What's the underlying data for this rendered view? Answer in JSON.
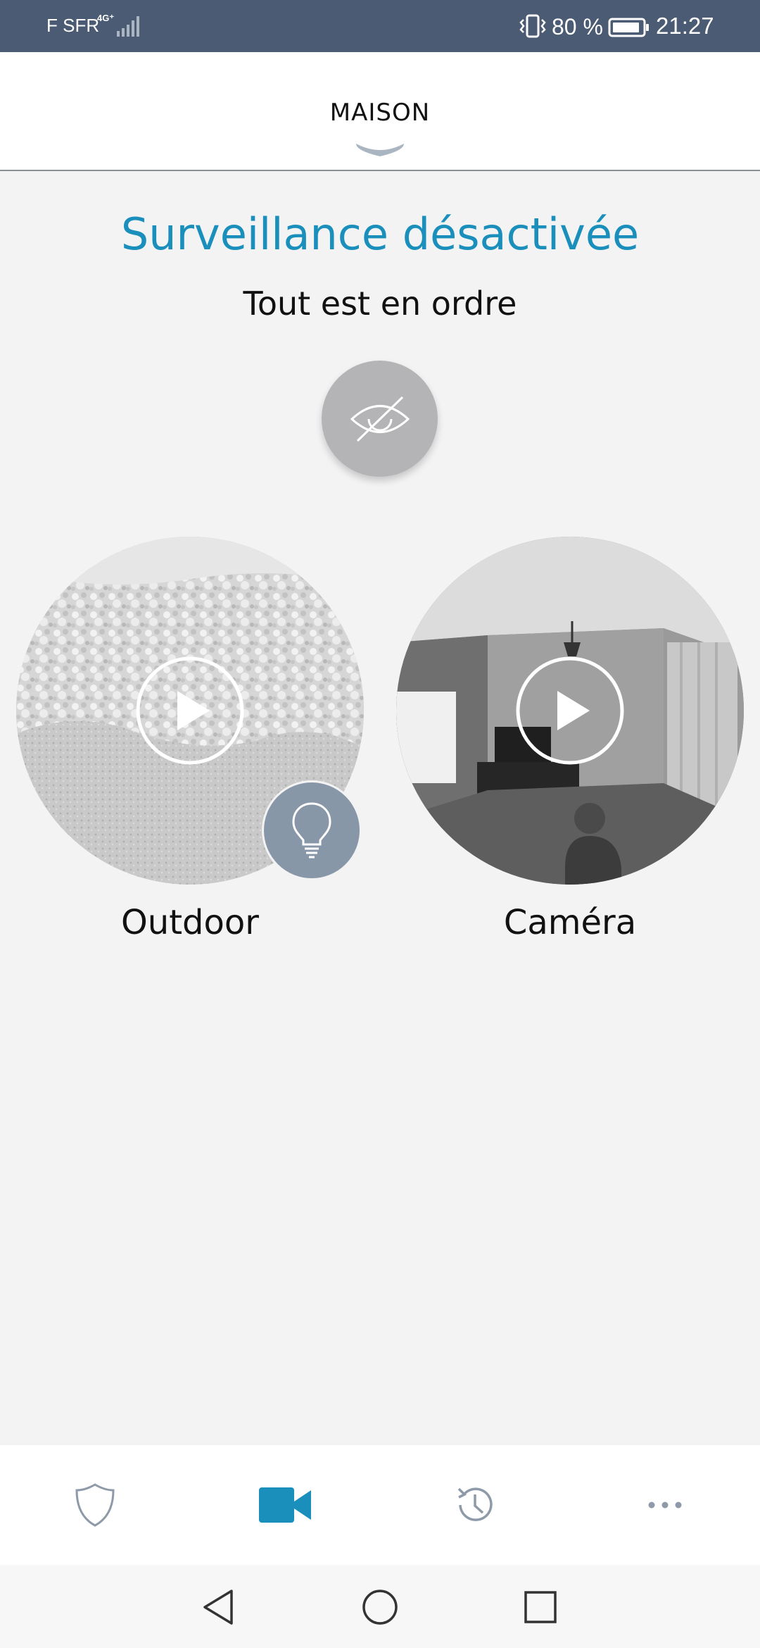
{
  "status_bar": {
    "carrier": "F SFR",
    "network": "4G⁺",
    "battery_percent": "80 %",
    "time": "21:27",
    "icons": [
      "signal-icon",
      "vibrate-icon",
      "battery-icon"
    ]
  },
  "header": {
    "title": "MAISON",
    "icon": "chevron-down-icon"
  },
  "status": {
    "headline": "Surveillance désactivée",
    "subline": "Tout est en ordre",
    "privacy_icon": "eye-off-icon"
  },
  "cameras": [
    {
      "label": "Outdoor",
      "icon": "play-icon",
      "extra_icon": "lightbulb-icon"
    },
    {
      "label": "Caméra",
      "icon": "play-icon"
    }
  ],
  "tabs": [
    {
      "icon": "shield-icon",
      "active": false
    },
    {
      "icon": "video-camera-icon",
      "active": true
    },
    {
      "icon": "history-icon",
      "active": false
    },
    {
      "icon": "more-icon",
      "active": false
    }
  ],
  "nav_bar": {
    "icons": [
      "back-icon",
      "home-icon",
      "recent-apps-icon"
    ]
  },
  "colors": {
    "status_bar": "#4a5b73",
    "accent": "#1a8fbb",
    "background": "#f3f3f4",
    "privacy_button": "#b4b4b6",
    "light_button": "#8897a8"
  }
}
